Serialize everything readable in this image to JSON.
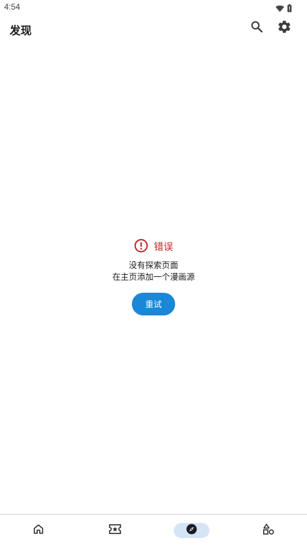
{
  "status_bar": {
    "time": "4:54",
    "icons": [
      "wifi-icon",
      "battery-icon"
    ]
  },
  "app_bar": {
    "title": "发现",
    "actions": [
      "search-icon",
      "settings-icon"
    ]
  },
  "error": {
    "title": "错误",
    "line1": "没有探索页面",
    "line2": "在主页添加一个漫画源",
    "retry_label": "重试",
    "accent_color": "#c0252b",
    "button_color": "#1a87d9"
  },
  "bottom_nav": {
    "items": [
      "home-icon",
      "ticket-icon",
      "compass-icon",
      "shapes-icon"
    ],
    "selected": "compass-icon",
    "indicator_color": "#d6e5f6"
  }
}
